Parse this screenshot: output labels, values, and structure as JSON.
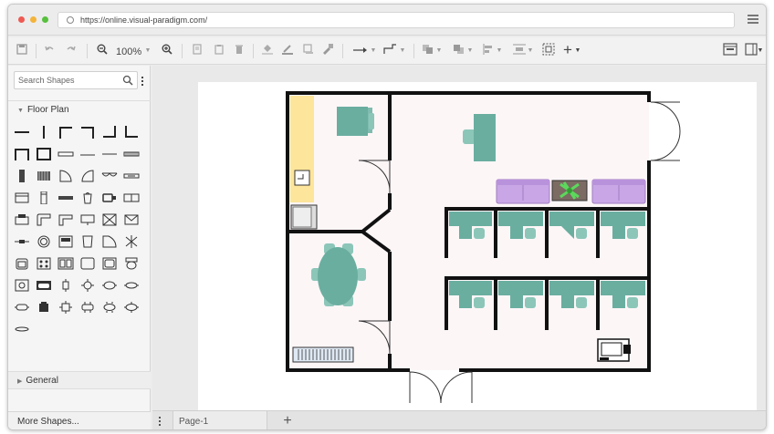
{
  "browser": {
    "url": "https://online.visual-paradigm.com/",
    "dots": [
      "#ee5a52",
      "#f4b43a",
      "#57c03d"
    ]
  },
  "toolbar": {
    "zoom_level": "100%",
    "undo_icon": "undo-icon",
    "redo_icon": "redo-icon"
  },
  "sidebar": {
    "search_placeholder": "Search Shapes",
    "sections": [
      {
        "label": "Floor Plan",
        "expanded": true
      },
      {
        "label": "General",
        "expanded": false
      }
    ],
    "more_shapes_label": "More Shapes..."
  },
  "pages": {
    "tabs": [
      {
        "label": "Page-1"
      }
    ],
    "add_icon": "plus-icon"
  },
  "colors": {
    "wall": "#111111",
    "furniture_teal": "#6aaea0",
    "furniture_teal_dark": "#5a9a8c",
    "sofa_purple": "#c9a7e6",
    "floor_tint": "#fdf6f7",
    "yellow_zone": "#fde59b"
  }
}
